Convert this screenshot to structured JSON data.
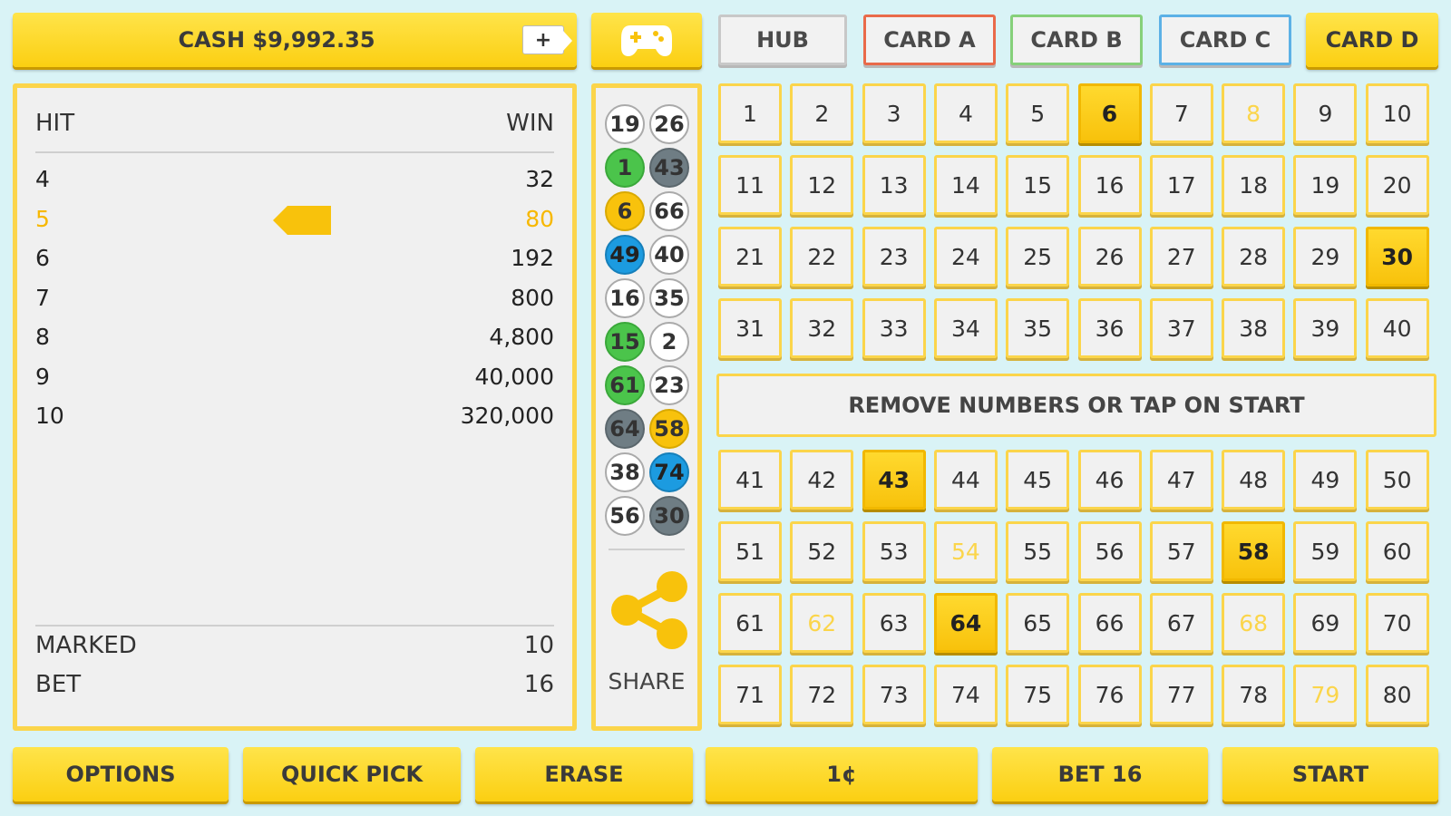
{
  "topbar": {
    "cash_label": "CASH $9,992.35",
    "add_cash_label": "+",
    "tabs": {
      "hub": "HUB",
      "card_a": "CARD A",
      "card_b": "CARD B",
      "card_c": "CARD C",
      "card_d": "CARD D"
    },
    "active_tab": "CARD D"
  },
  "paytable": {
    "hit_header": "HIT",
    "win_header": "WIN",
    "rows": [
      {
        "hit": "4",
        "win": "32"
      },
      {
        "hit": "5",
        "win": "80"
      },
      {
        "hit": "6",
        "win": "192"
      },
      {
        "hit": "7",
        "win": "800"
      },
      {
        "hit": "8",
        "win": "4,800"
      },
      {
        "hit": "9",
        "win": "40,000"
      },
      {
        "hit": "10",
        "win": "320,000"
      }
    ],
    "active_hit": "5",
    "marked_label": "MARKED",
    "marked_value": "10",
    "bet_label": "BET",
    "bet_value": "16"
  },
  "drawn_balls": [
    {
      "n": "19",
      "style": "white"
    },
    {
      "n": "26",
      "style": "white"
    },
    {
      "n": "1",
      "style": "green"
    },
    {
      "n": "43",
      "style": "dark"
    },
    {
      "n": "6",
      "style": "yellow"
    },
    {
      "n": "66",
      "style": "white"
    },
    {
      "n": "49",
      "style": "blue"
    },
    {
      "n": "40",
      "style": "white"
    },
    {
      "n": "16",
      "style": "white"
    },
    {
      "n": "35",
      "style": "white"
    },
    {
      "n": "15",
      "style": "green"
    },
    {
      "n": "2",
      "style": "white"
    },
    {
      "n": "61",
      "style": "green"
    },
    {
      "n": "23",
      "style": "white"
    },
    {
      "n": "64",
      "style": "dark"
    },
    {
      "n": "58",
      "style": "yellow"
    },
    {
      "n": "38",
      "style": "white"
    },
    {
      "n": "74",
      "style": "blue"
    },
    {
      "n": "56",
      "style": "white"
    },
    {
      "n": "30",
      "style": "dark"
    }
  ],
  "share_label": "SHARE",
  "grid": {
    "selected": [
      "6",
      "30",
      "43",
      "58",
      "64"
    ],
    "highlighted": [
      "8",
      "54",
      "62",
      "68",
      "79"
    ]
  },
  "status_message": "REMOVE NUMBERS OR TAP ON START",
  "bottombar": {
    "options": "OPTIONS",
    "quick_pick": "QUICK PICK",
    "erase": "ERASE",
    "denomination": "1¢",
    "bet": "BET 16",
    "start": "START"
  },
  "colors": {
    "accent_yellow": "#f8c20c",
    "background": "#d9f3f6",
    "ball_green": "#4bc44b",
    "ball_blue": "#1c9be0",
    "ball_dark": "#6f7d84"
  }
}
